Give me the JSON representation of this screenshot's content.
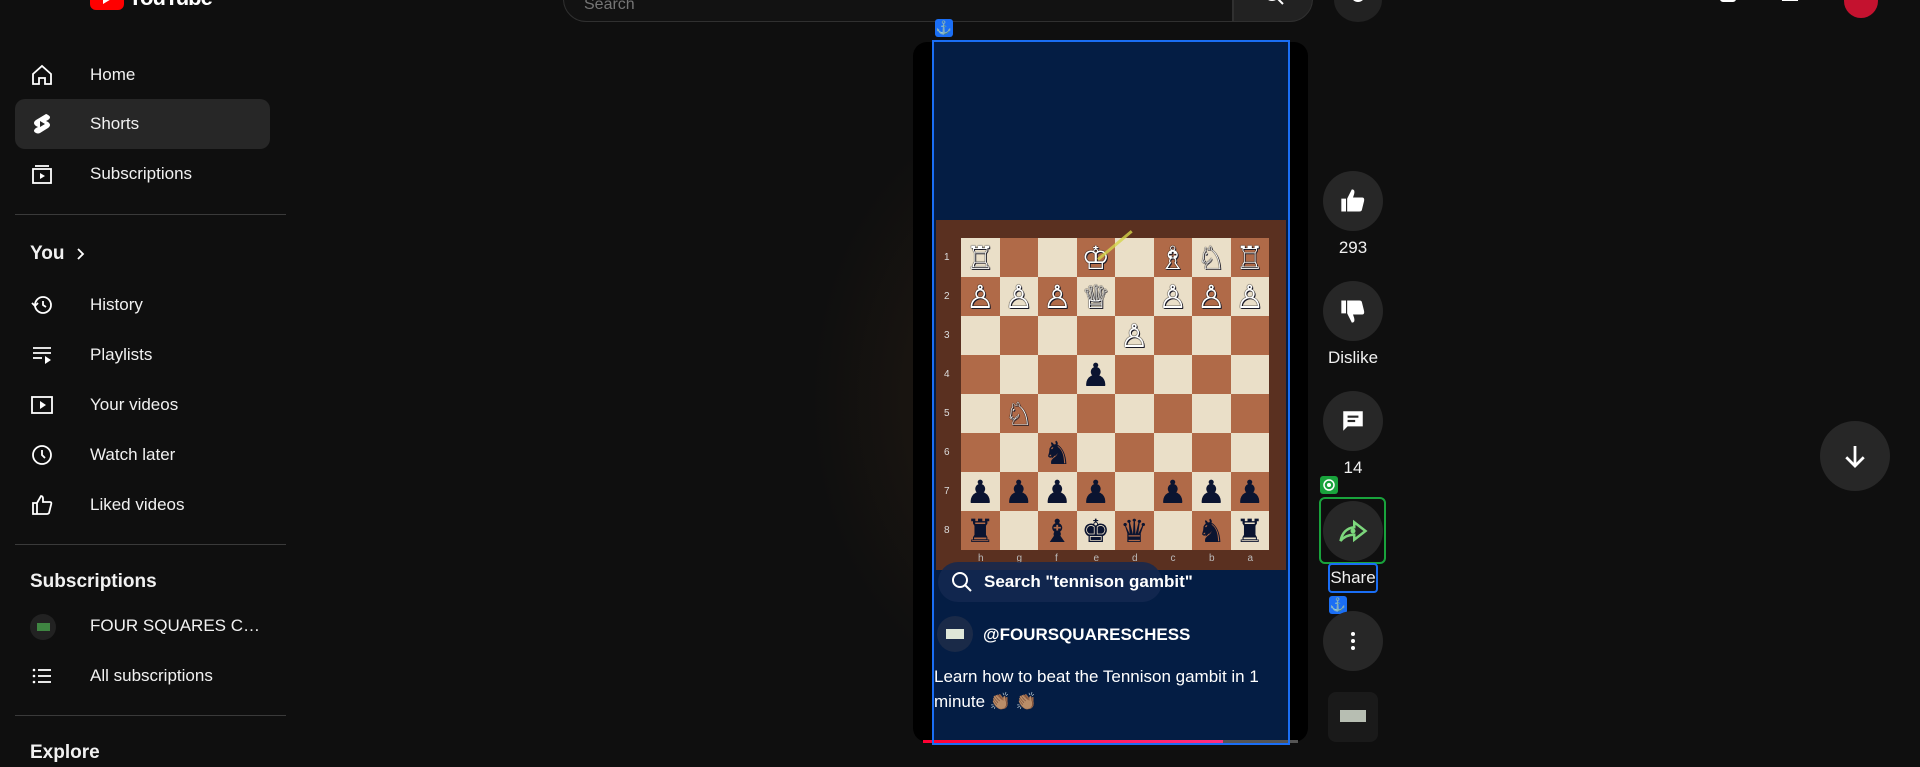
{
  "header": {
    "logo_text": "YouTube",
    "search_placeholder": "Search"
  },
  "sidebar": {
    "main": [
      {
        "label": "Home"
      },
      {
        "label": "Shorts"
      },
      {
        "label": "Subscriptions"
      }
    ],
    "you_heading": "You",
    "you_items": [
      {
        "label": "History"
      },
      {
        "label": "Playlists"
      },
      {
        "label": "Your videos"
      },
      {
        "label": "Watch later"
      },
      {
        "label": "Liked videos"
      }
    ],
    "subscriptions_heading": "Subscriptions",
    "subscriptions": [
      {
        "label": "FOUR SQUARES CH..."
      },
      {
        "label": "All subscriptions"
      }
    ],
    "explore_heading": "Explore"
  },
  "short": {
    "search_chip": "Search \"tennison gambit\"",
    "channel_handle": "@FOURSQUARESCHESS",
    "description": "Learn how to beat the Tennison gambit in 1 minute 👏🏽 👏🏽",
    "progress": 0.8,
    "board": {
      "ranks": [
        "1",
        "2",
        "3",
        "4",
        "5",
        "6",
        "7",
        "8"
      ],
      "files": [
        "h",
        "g",
        "f",
        "e",
        "d",
        "c",
        "b",
        "a"
      ],
      "rows": [
        [
          "wR",
          "",
          "",
          "wK",
          "",
          "wB",
          "wN",
          "wR"
        ],
        [
          "wP",
          "wP",
          "wP",
          "wQ",
          "",
          "wP",
          "wP",
          "wP"
        ],
        [
          "",
          "",
          "",
          "",
          "wP",
          "",
          "",
          ""
        ],
        [
          "",
          "",
          "",
          "bP",
          "",
          "",
          "",
          ""
        ],
        [
          "",
          "wN",
          "",
          "",
          "",
          "",
          "",
          ""
        ],
        [
          "",
          "",
          "bN",
          "",
          "",
          "",
          "",
          ""
        ],
        [
          "bP",
          "bP",
          "bP",
          "bP",
          "",
          "bP",
          "bP",
          "bP"
        ],
        [
          "bR",
          "",
          "bB",
          "bK",
          "bQ",
          "",
          "bN",
          "bR"
        ]
      ]
    }
  },
  "actions": {
    "like_count": "293",
    "dislike_label": "Dislike",
    "comment_count": "14",
    "share_label": "Share"
  },
  "colors": {
    "background": "#0f0f0f",
    "accent": "#ff0000",
    "overlay_blue": "#1a6ef5",
    "overlay_green": "#19a33c"
  }
}
